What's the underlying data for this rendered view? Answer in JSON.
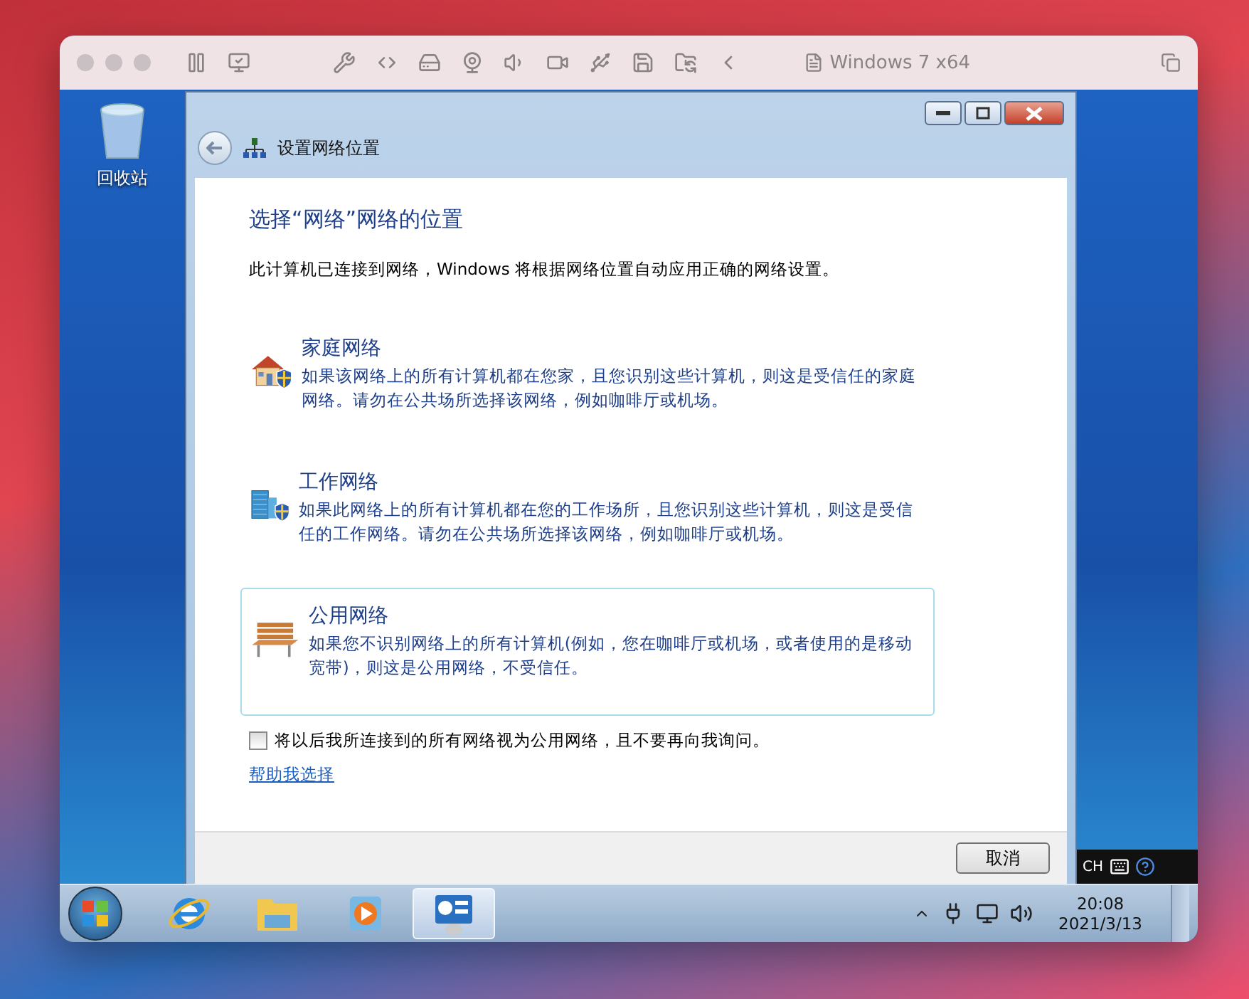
{
  "host_window": {
    "title": "Windows 7 x64"
  },
  "desktop": {
    "icons": [
      {
        "label": "回收站"
      }
    ]
  },
  "dialog": {
    "title": "设置网络位置",
    "heading": "选择“网络”网络的位置",
    "intro": "此计算机已连接到网络，Windows 将根据网络位置自动应用正确的网络设置。",
    "options": [
      {
        "kind": "home",
        "title": "家庭网络",
        "description": "如果该网络上的所有计算机都在您家，且您识别这些计算机，则这是受信任的家庭网络。请勿在公共场所选择该网络，例如咖啡厅或机场。",
        "selected": false
      },
      {
        "kind": "work",
        "title": "工作网络",
        "description": "如果此网络上的所有计算机都在您的工作场所，且您识别这些计算机，则这是受信任的工作网络。请勿在公共场所选择该网络，例如咖啡厅或机场。",
        "selected": false
      },
      {
        "kind": "public",
        "title": "公用网络",
        "description": "如果您不识别网络上的所有计算机(例如，您在咖啡厅或机场，或者使用的是移动宽带)，则这是公用网络，不受信任。",
        "selected": true
      }
    ],
    "checkbox": {
      "label": "将以后我所连接到的所有网络视为公用网络，且不要再向我询问。",
      "checked": false
    },
    "help_link": "帮助我选择",
    "buttons": [
      "取消"
    ]
  },
  "language_bar": {
    "label": "CH"
  },
  "taskbar": {
    "items": [
      {
        "kind": "browser",
        "selected": false
      },
      {
        "kind": "folder",
        "selected": false
      },
      {
        "kind": "media",
        "selected": false
      },
      {
        "kind": "network",
        "selected": true
      }
    ],
    "clock": {
      "time": "20:08",
      "date": "2021/3/13"
    }
  }
}
